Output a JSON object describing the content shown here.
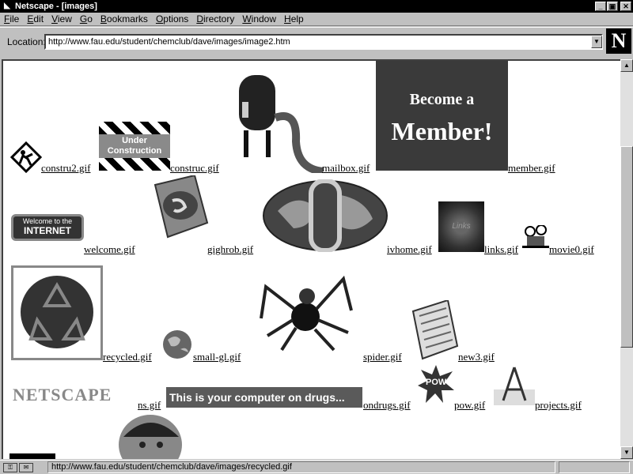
{
  "window": {
    "title": "Netscape - [images]"
  },
  "menu": [
    "File",
    "Edit",
    "View",
    "Go",
    "Bookmarks",
    "Options",
    "Directory",
    "Window",
    "Help"
  ],
  "location": {
    "label": "Location:",
    "url": "http://www.fau.edu/student/chemclub/dave/images/image2.htm"
  },
  "images": {
    "construction_sign_text": "Under Construction",
    "member_text_1": "Become a",
    "member_text_2": "Member!",
    "welcome_sign_line1": "Welcome to the",
    "welcome_sign_line2": "INTERNET",
    "links_text": "Links",
    "netscape_text": "NETSCAPE",
    "drugs_text": "This is your computer on drugs...",
    "pow_text": "POW"
  },
  "links": {
    "constru2": "constru2.gif",
    "construc": "construc.gif",
    "mailbox": "mailbox.gif",
    "member": "member.gif",
    "welcome": "welcome.gif",
    "gighrob": "gighrob.gif",
    "ivhome": "ivhome.gif",
    "links": "links.gif",
    "movie0": "movie0.gif",
    "recycled": "recycled.gif",
    "small_gl": "small-gl.gif",
    "spider": "spider.gif",
    "new3": "new3.gif",
    "ns": "ns.gif",
    "ondrugs": "ondrugs.gif",
    "pow": "pow.gif",
    "projects": "projects.gif"
  },
  "status": {
    "text": "http://www.fau.edu/student/chemclub/dave/images/recycled.gif"
  },
  "logo": "N"
}
